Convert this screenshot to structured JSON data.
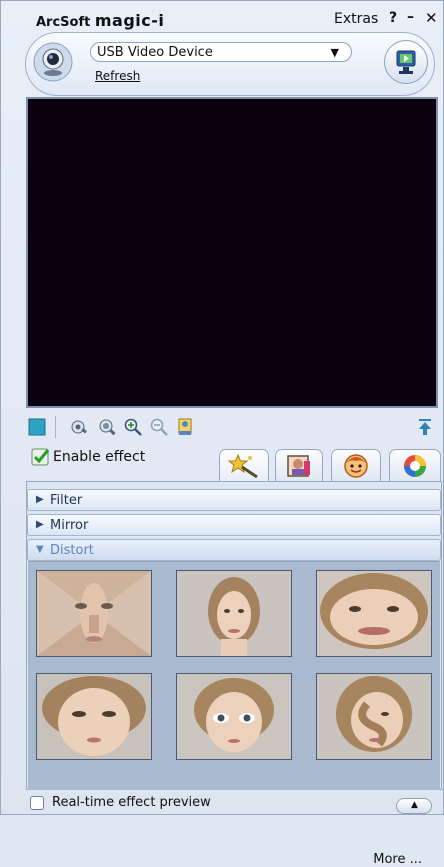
{
  "app": {
    "brand": "ArcSoft",
    "product": "magic-i",
    "menu": {
      "extras_label": "Extras",
      "help_label": "?",
      "minimize_label": "–",
      "close_label": "✕"
    }
  },
  "device": {
    "selected": "USB Video Device",
    "refresh_label": "Refresh"
  },
  "controls": {
    "enable_effect_label": "Enable effect",
    "enable_effect_checked": true
  },
  "effects": {
    "categories": [
      {
        "name": "Filter",
        "expanded": false
      },
      {
        "name": "Mirror",
        "expanded": false
      },
      {
        "name": "Distort",
        "expanded": true
      }
    ],
    "more_label": "More ..."
  },
  "footer": {
    "realtime_label": "Real-time effect preview",
    "realtime_checked": false
  },
  "icons": [
    "webcam-icon",
    "capture-icon",
    "stop-icon",
    "tune-icon",
    "settings-icon",
    "zoom-in-icon",
    "zoom-out-icon",
    "snapshot-icon",
    "pin-icon",
    "check-icon",
    "effects-tab-icon",
    "frames-tab-icon",
    "face-tab-icon",
    "color-tab-icon"
  ],
  "colors": {
    "accent": "#5b86c2",
    "preview_bg": "#0b0010"
  }
}
